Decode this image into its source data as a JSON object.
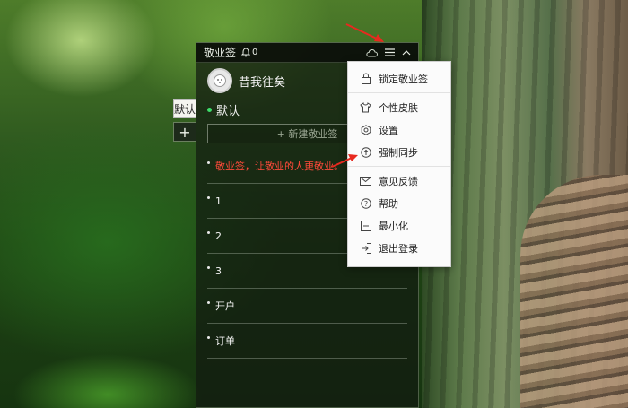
{
  "app": {
    "title": "敬业签",
    "notification_count": "0"
  },
  "side_tabs": [
    "默认",
    "+"
  ],
  "user": {
    "name": "昔我往矣"
  },
  "category": {
    "name": "默认"
  },
  "new_note_button": "+ 新建敬业签",
  "notes": [
    {
      "text": "敬业签，让敬业的人更敬业。",
      "color": "#ff4a3a"
    },
    {
      "text": "1"
    },
    {
      "text": "2"
    },
    {
      "text": "3"
    },
    {
      "text": "开户"
    },
    {
      "text": "订单"
    }
  ],
  "menu": {
    "items": [
      {
        "label": "锁定敬业签",
        "icon": "lock-icon"
      },
      {
        "label": "个性皮肤",
        "icon": "shirt-icon"
      },
      {
        "label": "设置",
        "icon": "gear-icon"
      },
      {
        "label": "强制同步",
        "icon": "upload-circle-icon"
      },
      {
        "label": "意见反馈",
        "icon": "mail-icon"
      },
      {
        "label": "帮助",
        "icon": "help-icon"
      },
      {
        "label": "最小化",
        "icon": "minimize-icon"
      },
      {
        "label": "退出登录",
        "icon": "logout-icon"
      }
    ]
  },
  "colors": {
    "accent_red": "#ff4a3a",
    "status_green": "#3ddc6a"
  }
}
